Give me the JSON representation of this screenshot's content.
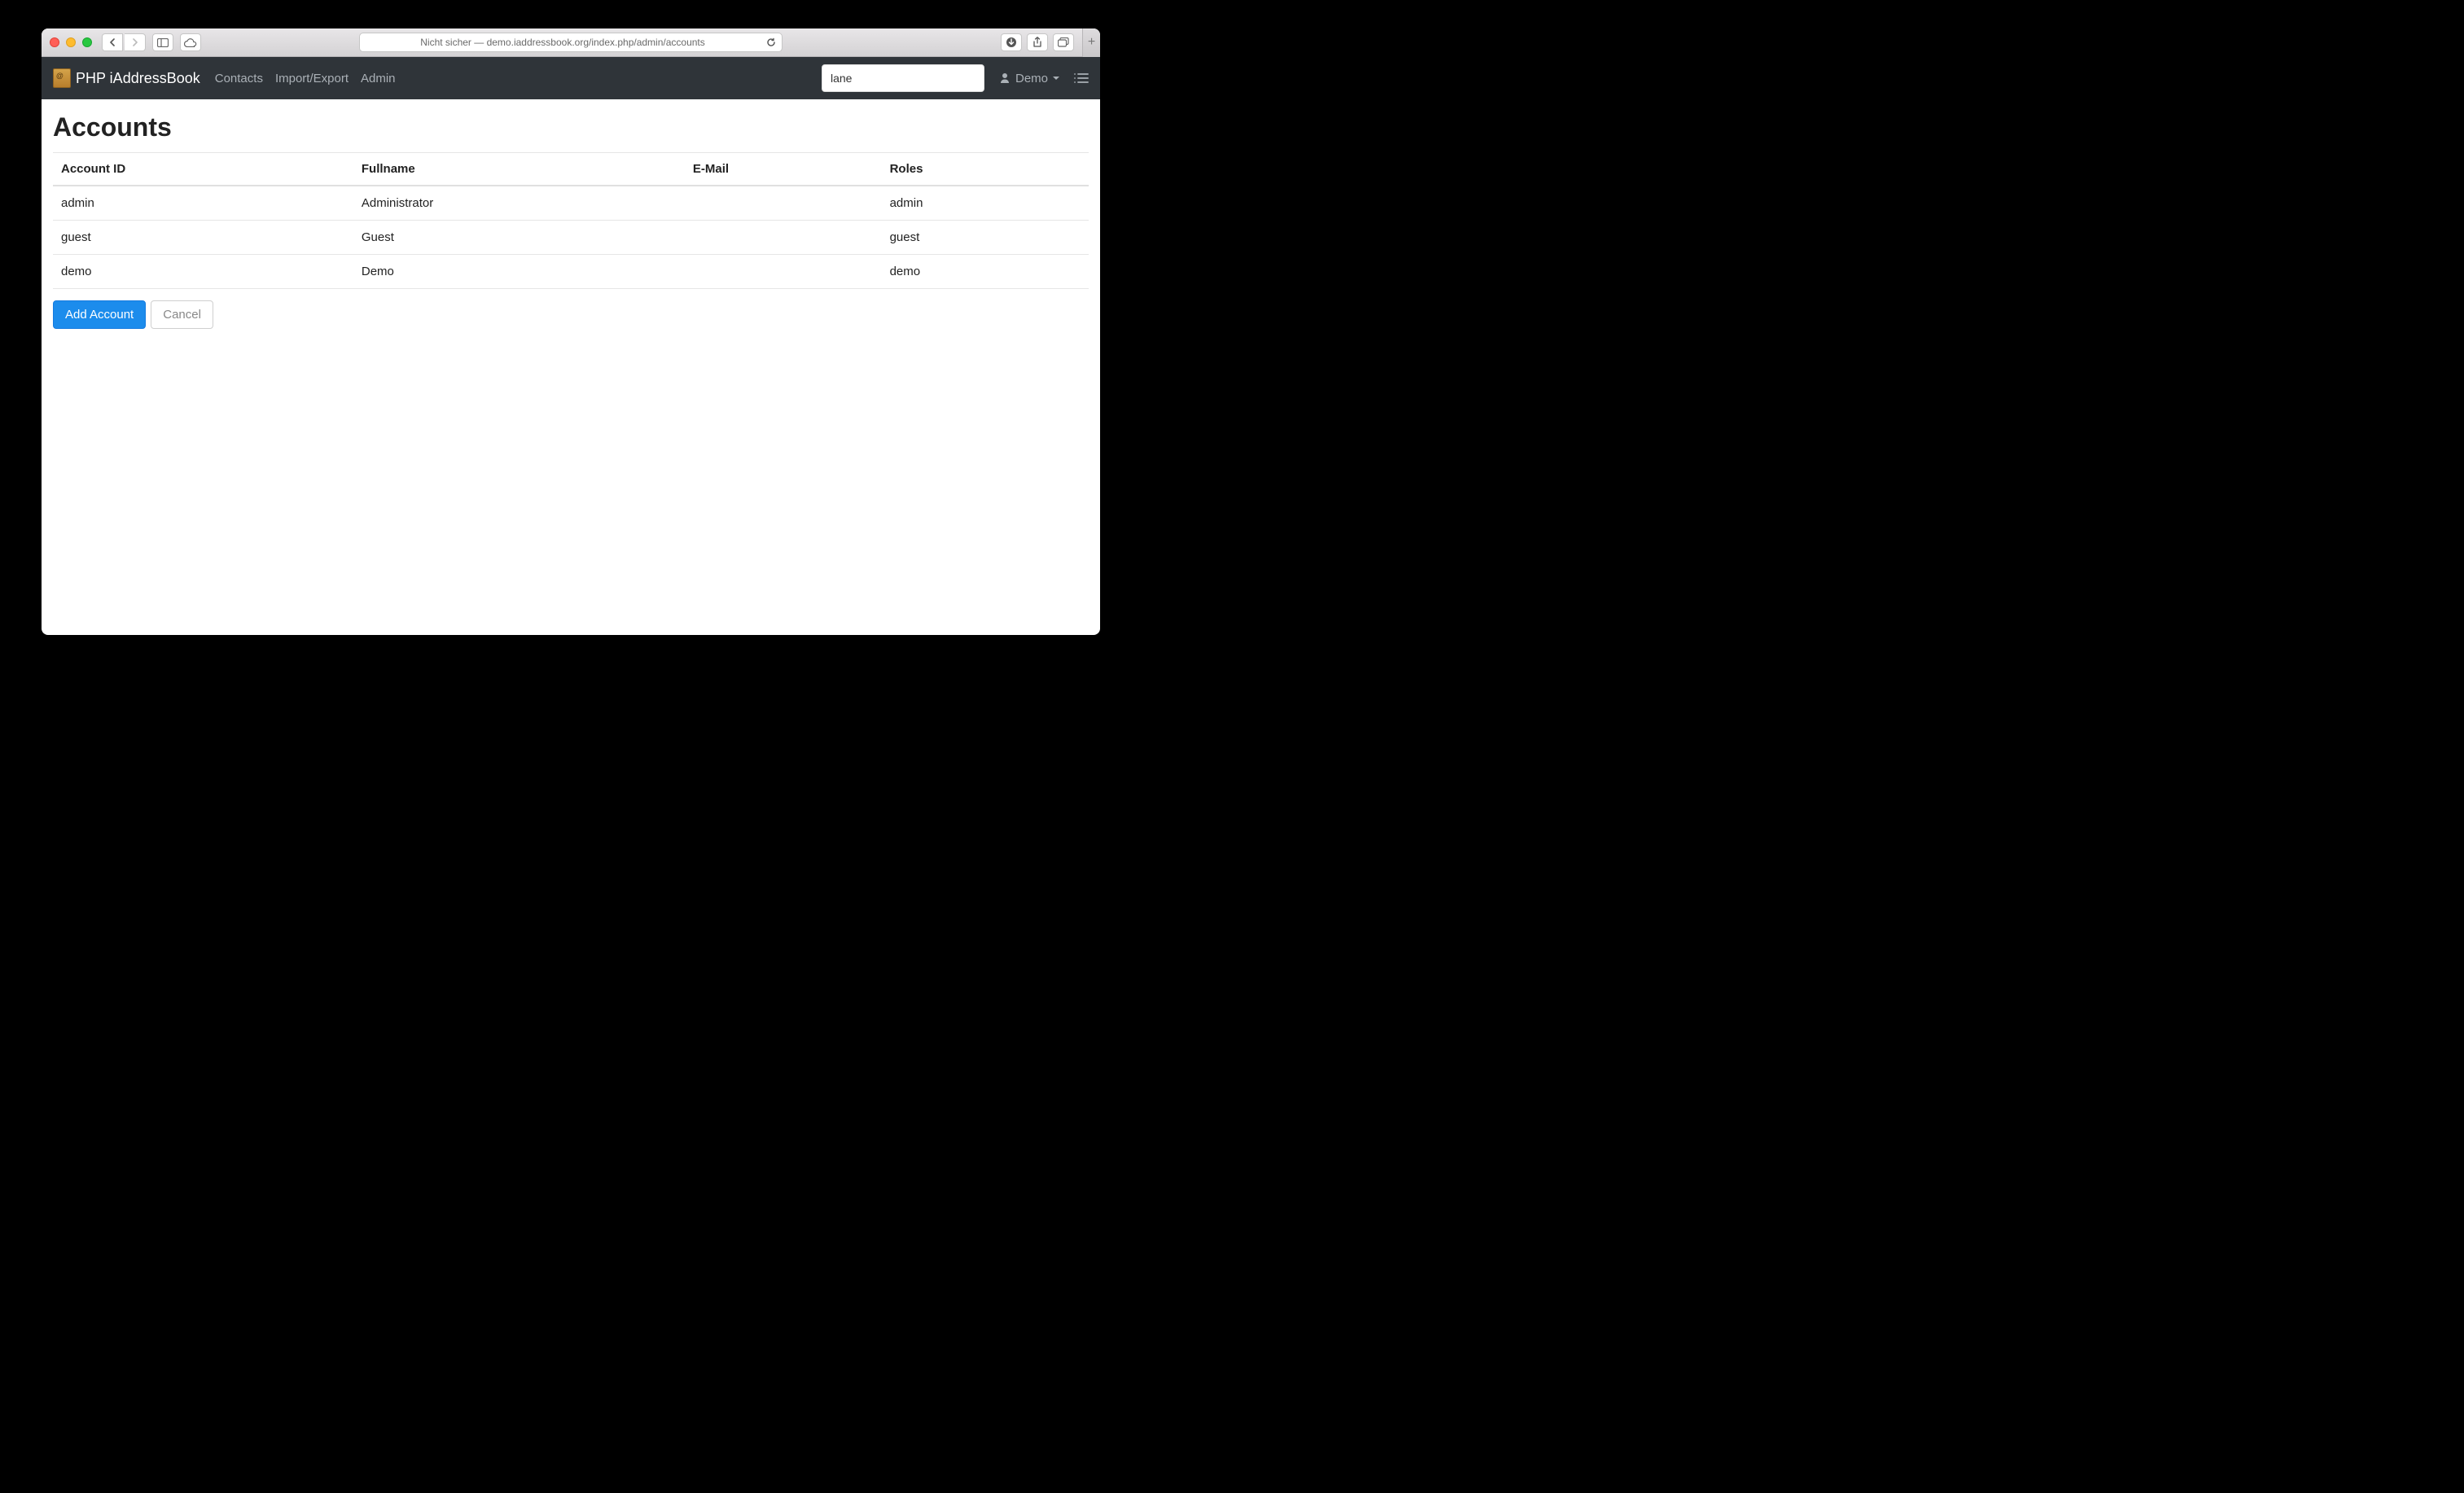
{
  "browser": {
    "url_text": "Nicht sicher — demo.iaddressbook.org/index.php/admin/accounts"
  },
  "navbar": {
    "brand": "PHP iAddressBook",
    "links": [
      "Contacts",
      "Import/Export",
      "Admin"
    ],
    "search_value": "lane",
    "user_label": "Demo"
  },
  "page": {
    "title": "Accounts",
    "columns": [
      "Account ID",
      "Fullname",
      "E-Mail",
      "Roles"
    ],
    "rows": [
      {
        "id": "admin",
        "fullname": "Administrator",
        "email": "",
        "roles": "admin"
      },
      {
        "id": "guest",
        "fullname": "Guest",
        "email": "",
        "roles": "guest"
      },
      {
        "id": "demo",
        "fullname": "Demo",
        "email": "",
        "roles": "demo"
      }
    ],
    "add_label": "Add Account",
    "cancel_label": "Cancel"
  }
}
